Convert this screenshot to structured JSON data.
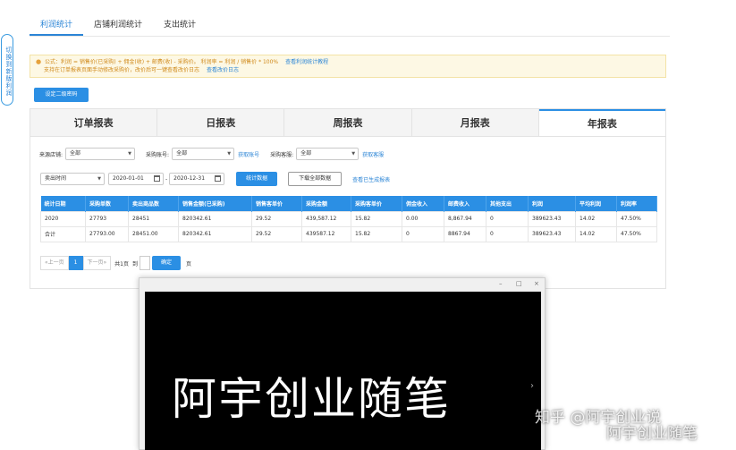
{
  "side_tab": {
    "label": "切换到新版利润"
  },
  "top_tabs": [
    {
      "label": "利润统计",
      "active": true
    },
    {
      "label": "店铺利润统计",
      "active": false
    },
    {
      "label": "支出统计",
      "active": false
    }
  ],
  "notice": {
    "line1": "公式：利润 = 销售价(已采购) + 佣金(收) + 邮费(收) - 采购价。 利润率 = 利润 / 销售价 * 100%",
    "line1_link": "查看利润统计教程",
    "line2": "支持在订单报表页面手动修改采购价，改价后可一键查看改价日志",
    "line2_link": "查看改价日志"
  },
  "setup_button": "设定二级密码",
  "report_tabs": [
    {
      "label": "订单报表",
      "active": false
    },
    {
      "label": "日报表",
      "active": false
    },
    {
      "label": "周报表",
      "active": false
    },
    {
      "label": "月报表",
      "active": false
    },
    {
      "label": "年报表",
      "active": true
    }
  ],
  "filters": {
    "store_label": "来源店铺:",
    "store_value": "全部",
    "account_label": "采购账号:",
    "account_value": "全部",
    "account_link": "获取账号",
    "tag_label": "采购客服:",
    "tag_value": "全部",
    "tag_link": "获取客服"
  },
  "row2": {
    "time_type": "卖出时间",
    "date_start": "2020-01-01",
    "date_sep": "-",
    "date_end": "2020-12-31",
    "stats_button": "统计数据",
    "download_button": "下载全部数据",
    "view_link": "查看已生成报表"
  },
  "table": {
    "headers": [
      "统计日期",
      "采购单数",
      "卖出商品数",
      "销售金额(已采购)",
      "销售客单价",
      "采购金额",
      "采购客单价",
      "佣金收入",
      "邮费收入",
      "其他支出",
      "利润",
      "平均利润",
      "利润率"
    ],
    "rows": [
      [
        "2020",
        "27793",
        "28451",
        "820342.61",
        "29.52",
        "439,587.12",
        "15.82",
        "0.00",
        "8,867.94",
        "0",
        "389623.43",
        "14.02",
        "47.50%"
      ],
      [
        "合计",
        "27793.00",
        "28451.00",
        "820342.61",
        "29.52",
        "439587.12",
        "15.82",
        "0",
        "8867.94",
        "0",
        "389623.43",
        "14.02",
        "47.50%"
      ]
    ]
  },
  "pager": {
    "prev": "«上一页",
    "current": "1",
    "next": "下一页»",
    "total": "共1页",
    "goto": "到",
    "confirm": "确定",
    "unit": "页"
  },
  "video": {
    "caption": "阿宇创业随笔",
    "minimize": "–",
    "maximize": "□",
    "close": "×",
    "arrow": "›"
  },
  "watermarks": {
    "zhihu": "知乎 @阿宇创业说",
    "wechat": "阿宇创业随笔"
  }
}
